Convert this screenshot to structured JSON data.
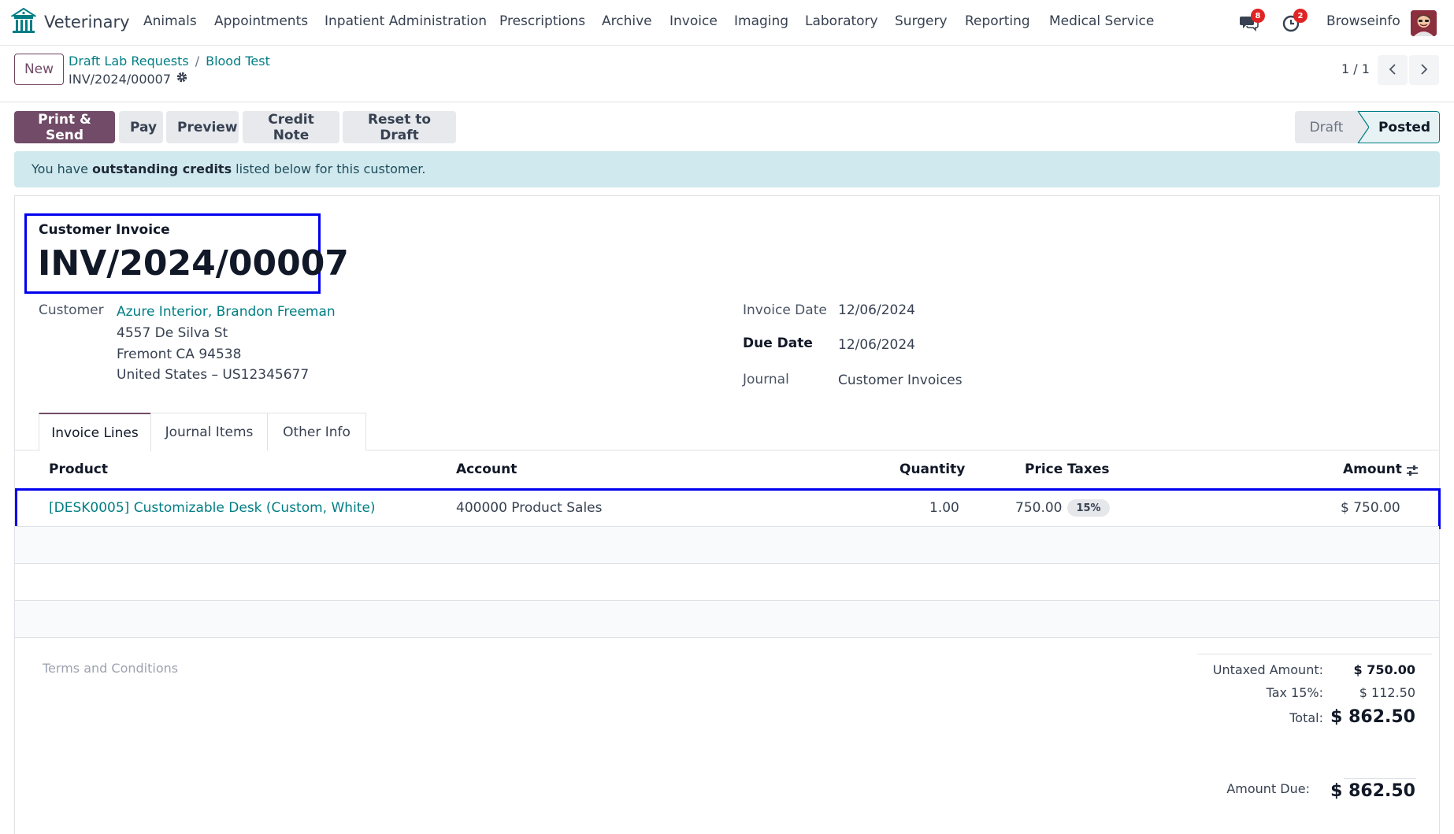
{
  "navbar": {
    "app_name": "Veterinary",
    "menu": [
      "Animals",
      "Appointments",
      "Inpatient Administration",
      "Prescriptions",
      "Archive",
      "Invoice",
      "Imaging",
      "Laboratory",
      "Surgery",
      "Reporting",
      "Medical Service"
    ],
    "messages_count": "8",
    "activities_count": "2",
    "company": "Browseinfo"
  },
  "control_panel": {
    "new_label": "New",
    "breadcrumbs": [
      "Draft Lab Requests",
      "Blood Test"
    ],
    "breadcrumb_sep": "/",
    "record_name": "INV/2024/00007",
    "pager": "1 / 1"
  },
  "actions": {
    "print_send": "Print & Send",
    "pay": "Pay",
    "preview": "Preview",
    "credit_note": "Credit Note",
    "reset_draft": "Reset to Draft"
  },
  "statusbar": {
    "draft": "Draft",
    "posted": "Posted"
  },
  "alert": {
    "prefix": "You have ",
    "bold": "outstanding credits",
    "suffix": " listed below for this customer."
  },
  "invoice": {
    "subtitle": "Customer Invoice",
    "number": "INV/2024/00007",
    "customer_label": "Customer",
    "customer_name": "Azure Interior, Brandon Freeman",
    "address_1": "4557 De Silva St",
    "address_2": "Fremont CA 94538",
    "address_3": "United States – US12345677",
    "invoice_date_label": "Invoice Date",
    "invoice_date": "12/06/2024",
    "due_date_label": "Due Date",
    "due_date": "12/06/2024",
    "journal_label": "Journal",
    "journal": "Customer Invoices"
  },
  "tabs": [
    "Invoice Lines",
    "Journal Items",
    "Other Info"
  ],
  "table": {
    "headers": {
      "product": "Product",
      "account": "Account",
      "quantity": "Quantity",
      "price": "Price",
      "taxes": "Taxes",
      "amount": "Amount"
    },
    "rows": [
      {
        "product": "[DESK0005] Customizable Desk (Custom, White)",
        "account": "400000 Product Sales",
        "quantity": "1.00",
        "price": "750.00",
        "tax": "15%",
        "amount": "$ 750.00"
      }
    ]
  },
  "footer": {
    "terms_placeholder": "Terms and Conditions",
    "untaxed_label": "Untaxed Amount:",
    "untaxed_value": "$ 750.00",
    "tax_label": "Tax 15%:",
    "tax_value": "$ 112.50",
    "total_label": "Total:",
    "total_value": "$ 862.50",
    "due_label": "Amount Due:",
    "due_value": "$ 862.50"
  },
  "colors": {
    "brand": "#714b67",
    "link": "#017e84",
    "highlight_box": "#0000ee",
    "alert_bg": "#d0e9ee"
  }
}
